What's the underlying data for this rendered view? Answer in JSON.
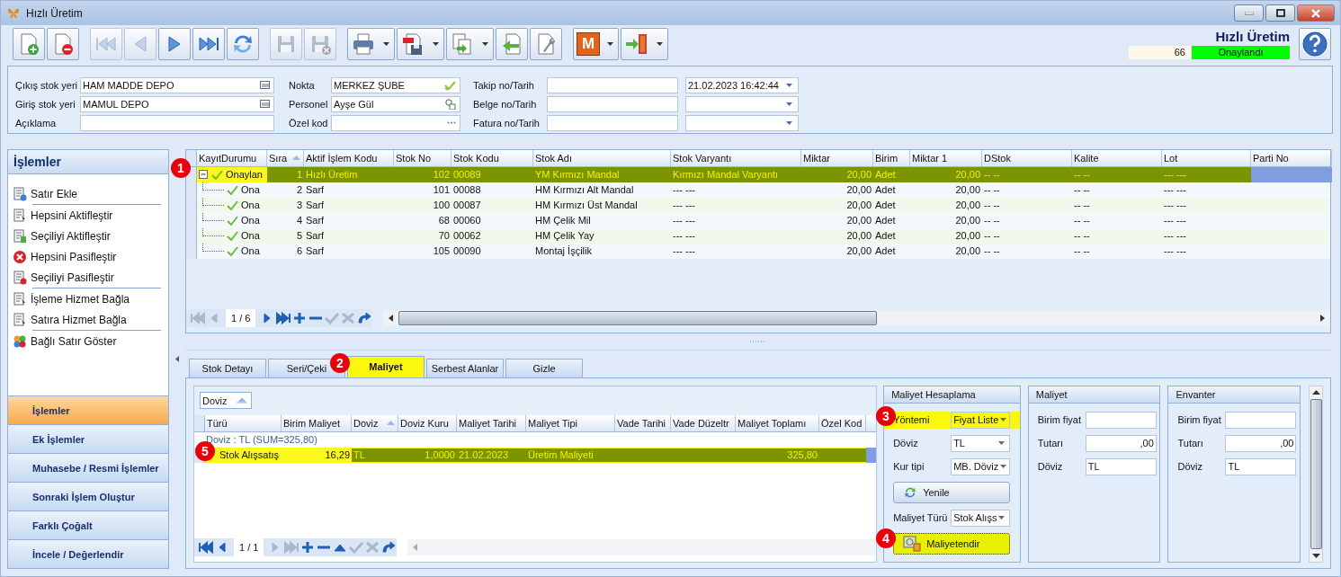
{
  "window": {
    "title": "Hızlı Üretim"
  },
  "toolbar": {
    "buttons": [
      {
        "kind": "new",
        "disabled": false,
        "menu": false
      },
      {
        "kind": "delete",
        "disabled": false,
        "menu": false
      },
      {
        "kind": "first",
        "disabled": true,
        "menu": false
      },
      {
        "kind": "prev",
        "disabled": true,
        "menu": false
      },
      {
        "kind": "next",
        "disabled": false,
        "menu": false
      },
      {
        "kind": "last",
        "disabled": false,
        "menu": false
      },
      {
        "kind": "refresh",
        "disabled": false,
        "menu": false
      },
      {
        "kind": "save",
        "disabled": true,
        "menu": false
      },
      {
        "kind": "save-cancel",
        "disabled": true,
        "menu": false
      },
      {
        "kind": "print",
        "disabled": false,
        "menu": true
      },
      {
        "kind": "pdf",
        "disabled": false,
        "menu": true
      },
      {
        "kind": "copy",
        "disabled": false,
        "menu": true
      },
      {
        "kind": "import",
        "disabled": false,
        "menu": false
      },
      {
        "kind": "tools",
        "disabled": false,
        "menu": false
      },
      {
        "kind": "m",
        "label": "M",
        "disabled": false,
        "menu": true
      },
      {
        "kind": "exit",
        "disabled": false,
        "menu": true
      }
    ],
    "title": "Hızlı Üretim",
    "record_no": "66",
    "status": "Onaylandı",
    "approved": true
  },
  "form": {
    "columns": [
      [
        {
          "kind": "lookup",
          "label": "Çıkış stok yeri",
          "value": "HAM MADDE DEPO"
        },
        {
          "kind": "lookup",
          "label": "Giriş stok yeri",
          "value": "MAMUL DEPO"
        },
        {
          "kind": "plain",
          "label": "Açıklama"
        }
      ],
      [
        {
          "kind": "check",
          "label": "Nokta",
          "value": "MERKEZ ŞUBE"
        },
        {
          "kind": "user",
          "label": "Personel",
          "value": "Ayşe Gül"
        },
        {
          "kind": "more",
          "label": "Özel kod"
        }
      ],
      [
        {
          "kind": "dated",
          "label": "Takip no/Tarih",
          "date": "21.02.2023 16:42:44"
        },
        {
          "kind": "dated",
          "label": "Belge no/Tarih"
        },
        {
          "kind": "dated",
          "label": "Fatura no/Tarih"
        }
      ]
    ]
  },
  "sidebar": {
    "title": "İşlemler",
    "action_groups": [
      [
        {
          "kind": "add",
          "label": "Satır Ekle"
        }
      ],
      [
        {
          "kind": "doc",
          "label": "Hepsini Aktifleştir"
        },
        {
          "kind": "activate",
          "label": "Seçiliyi Aktifleştir"
        },
        {
          "kind": "remove",
          "label": "Hepsini Pasifleştir"
        },
        {
          "kind": "doc-x",
          "label": "Seçiliyi Pasifleştir"
        }
      ],
      [
        {
          "kind": "doc",
          "label": "İşleme Hizmet Bağla"
        },
        {
          "kind": "doc",
          "label": "Satıra Hizmet Bağla"
        }
      ],
      [
        {
          "kind": "balls",
          "label": "Bağlı Satır Göster"
        }
      ]
    ],
    "sections": [
      {
        "label": "İşlemler",
        "selected": true
      },
      {
        "label": "Ek İşlemler",
        "selected": false
      },
      {
        "label": "Muhasebe / Resmi İşlemler",
        "selected": false
      },
      {
        "label": "Sonraki İşlem Oluştur",
        "selected": false
      },
      {
        "label": "Farklı Çoğalt",
        "selected": false
      },
      {
        "label": "İncele / Değerlendir",
        "selected": false
      }
    ]
  },
  "grid": {
    "columns": [
      {
        "label": "KayıtDurumu",
        "sorted": false
      },
      {
        "label": "Sıra",
        "sorted": true
      },
      {
        "label": "Aktif İşlem Kodu",
        "sorted": false
      },
      {
        "label": "Stok No",
        "sorted": false
      },
      {
        "label": "Stok Kodu",
        "sorted": false
      },
      {
        "label": "Stok Adı",
        "sorted": false
      },
      {
        "label": "Stok Varyantı",
        "sorted": false
      },
      {
        "label": "Miktar",
        "sorted": false
      },
      {
        "label": "Birim",
        "sorted": false
      },
      {
        "label": "Miktar 1",
        "sorted": false
      },
      {
        "label": "DStok",
        "sorted": false
      },
      {
        "label": "Kalite",
        "sorted": false
      },
      {
        "label": "Lot",
        "sorted": false
      },
      {
        "label": "Parti No",
        "sorted": false
      }
    ],
    "rows": [
      {
        "selected": true,
        "highlighted": true,
        "expanded": true,
        "cells": [
          "Onaylan",
          "1",
          "Hızlı Üretim",
          "102",
          "00089",
          "YM Kırmızı Mandal",
          "Kırmızı Mandal Varyantı",
          "20,00",
          "Adet",
          "20,00",
          "-- --",
          "-- --",
          "--- ---"
        ],
        "children": [
          {
            "selected": false,
            "highlighted": false,
            "cells": [
              "Ona",
              "2",
              "Sarf",
              "101",
              "00088",
              "HM Kırmızı Alt Mandal",
              "--- ---",
              "20,00",
              "Adet",
              "20,00",
              "-- --",
              "-- --",
              "--- ---"
            ]
          },
          {
            "selected": false,
            "highlighted": false,
            "cells": [
              "Ona",
              "3",
              "Sarf",
              "100",
              "00087",
              "HM Kırmızı Üst Mandal",
              "--- ---",
              "20,00",
              "Adet",
              "20,00",
              "-- --",
              "-- --",
              "--- ---"
            ]
          },
          {
            "selected": false,
            "highlighted": false,
            "cells": [
              "Ona",
              "4",
              "Sarf",
              "68",
              "00060",
              "HM Çelik Mil",
              "--- ---",
              "20,00",
              "Adet",
              "20,00",
              "-- --",
              "-- --",
              "--- ---"
            ]
          },
          {
            "selected": false,
            "highlighted": false,
            "cells": [
              "Ona",
              "5",
              "Sarf",
              "70",
              "00062",
              "HM Çelik Yay",
              "--- ---",
              "20,00",
              "Adet",
              "20,00",
              "-- --",
              "-- --",
              "--- ---"
            ]
          },
          {
            "selected": false,
            "highlighted": false,
            "cells": [
              "Ona",
              "6",
              "Sarf",
              "105",
              "00090",
              "Montaj İşçilik",
              "--- ---",
              "20,00",
              "Adet",
              "20,00",
              "-- --",
              "-- --",
              "--- ---"
            ]
          }
        ]
      }
    ],
    "pager": [
      {
        "kind": "first",
        "disabled": true
      },
      {
        "kind": "prev",
        "disabled": true
      },
      {
        "kind": "page",
        "label": "1 / 6"
      },
      {
        "kind": "next",
        "disabled": false
      },
      {
        "kind": "last",
        "disabled": false
      },
      {
        "kind": "add",
        "disabled": false
      },
      {
        "kind": "remove",
        "disabled": false
      },
      {
        "kind": "confirm",
        "disabled": true
      },
      {
        "kind": "cancel",
        "disabled": true
      },
      {
        "kind": "redo",
        "disabled": false
      }
    ]
  },
  "tabs": [
    {
      "label": "Stok Detayı",
      "selected": false,
      "highlighted": false
    },
    {
      "label": "Seri/Çeki",
      "selected": false,
      "highlighted": false
    },
    {
      "label": "Maliyet",
      "selected": true,
      "highlighted": true
    },
    {
      "label": "Serbest Alanlar",
      "selected": false,
      "highlighted": false
    },
    {
      "label": "Gizle",
      "selected": false,
      "highlighted": false
    }
  ],
  "cost_grid": {
    "group_by": "Doviz",
    "columns": [
      {
        "label": "Türü",
        "sorted": false
      },
      {
        "label": "Birim Maliyet",
        "sorted": false
      },
      {
        "label": "Doviz",
        "sorted": true
      },
      {
        "label": "Doviz Kuru",
        "sorted": false
      },
      {
        "label": "Maliyet Tarihi",
        "sorted": false
      },
      {
        "label": "Maliyet Tipi",
        "sorted": false
      },
      {
        "label": "Vade Tarihi",
        "sorted": false
      },
      {
        "label": "Vade Düzeltr",
        "sorted": false
      },
      {
        "label": "Maliyet Toplamı",
        "sorted": false
      },
      {
        "label": "Özel Kod",
        "sorted": false
      }
    ],
    "group_row": "Doviz : TL (SUM=325,80)",
    "rows": [
      {
        "selected": true,
        "highlighted": true,
        "cells": [
          "Stok Alışsatış",
          "16,29",
          "TL",
          "1,0000",
          "21.02.2023",
          "Üretim Maliyeti",
          null,
          null,
          "325,80",
          null
        ]
      }
    ],
    "pager": [
      {
        "kind": "first",
        "disabled": false
      },
      {
        "kind": "prev",
        "disabled": false
      },
      {
        "kind": "page",
        "label": "1 / 1"
      },
      {
        "kind": "next",
        "disabled": true
      },
      {
        "kind": "last",
        "disabled": true
      },
      {
        "kind": "add",
        "disabled": false
      },
      {
        "kind": "remove",
        "disabled": false
      },
      {
        "kind": "up",
        "disabled": false
      },
      {
        "kind": "confirm",
        "disabled": true
      },
      {
        "kind": "cancel",
        "disabled": true
      },
      {
        "kind": "redo",
        "disabled": false
      }
    ]
  },
  "cost_calc": {
    "title": "Maliyet Hesaplama",
    "items": [
      {
        "kind": "select",
        "label": "Yöntemi",
        "value": "Fiyat Liste",
        "highlighted": true
      },
      {
        "kind": "select",
        "label": "Döviz",
        "value": "TL",
        "highlighted": false
      },
      {
        "kind": "select",
        "label": "Kur tipi",
        "value": "MB. Döviz",
        "highlighted": false
      },
      {
        "kind": "refresh",
        "label": "Yenile",
        "highlighted": false
      },
      {
        "kind": "select",
        "label": "Maliyet Türü",
        "value": "Stok Alışs",
        "highlighted": false
      },
      {
        "kind": "costing",
        "label": "Maliyetendir",
        "highlighted": true
      }
    ]
  },
  "value_panels": [
    {
      "title": "Maliyet",
      "fields": [
        {
          "kind": "amount",
          "label": "Birim fiyat"
        },
        {
          "kind": "amount",
          "label": "Tutarı",
          "value": ",00"
        },
        {
          "kind": "text",
          "label": "Döviz",
          "value": "TL"
        }
      ]
    },
    {
      "title": "Envanter",
      "fields": [
        {
          "kind": "amount",
          "label": "Birim fiyat"
        },
        {
          "kind": "amount",
          "label": "Tutarı",
          "value": ",00"
        },
        {
          "kind": "text",
          "label": "Döviz",
          "value": "TL"
        }
      ]
    }
  ],
  "annotations": [
    {
      "number": "1"
    },
    {
      "number": "2"
    },
    {
      "number": "3"
    },
    {
      "number": "4"
    },
    {
      "number": "5"
    }
  ]
}
